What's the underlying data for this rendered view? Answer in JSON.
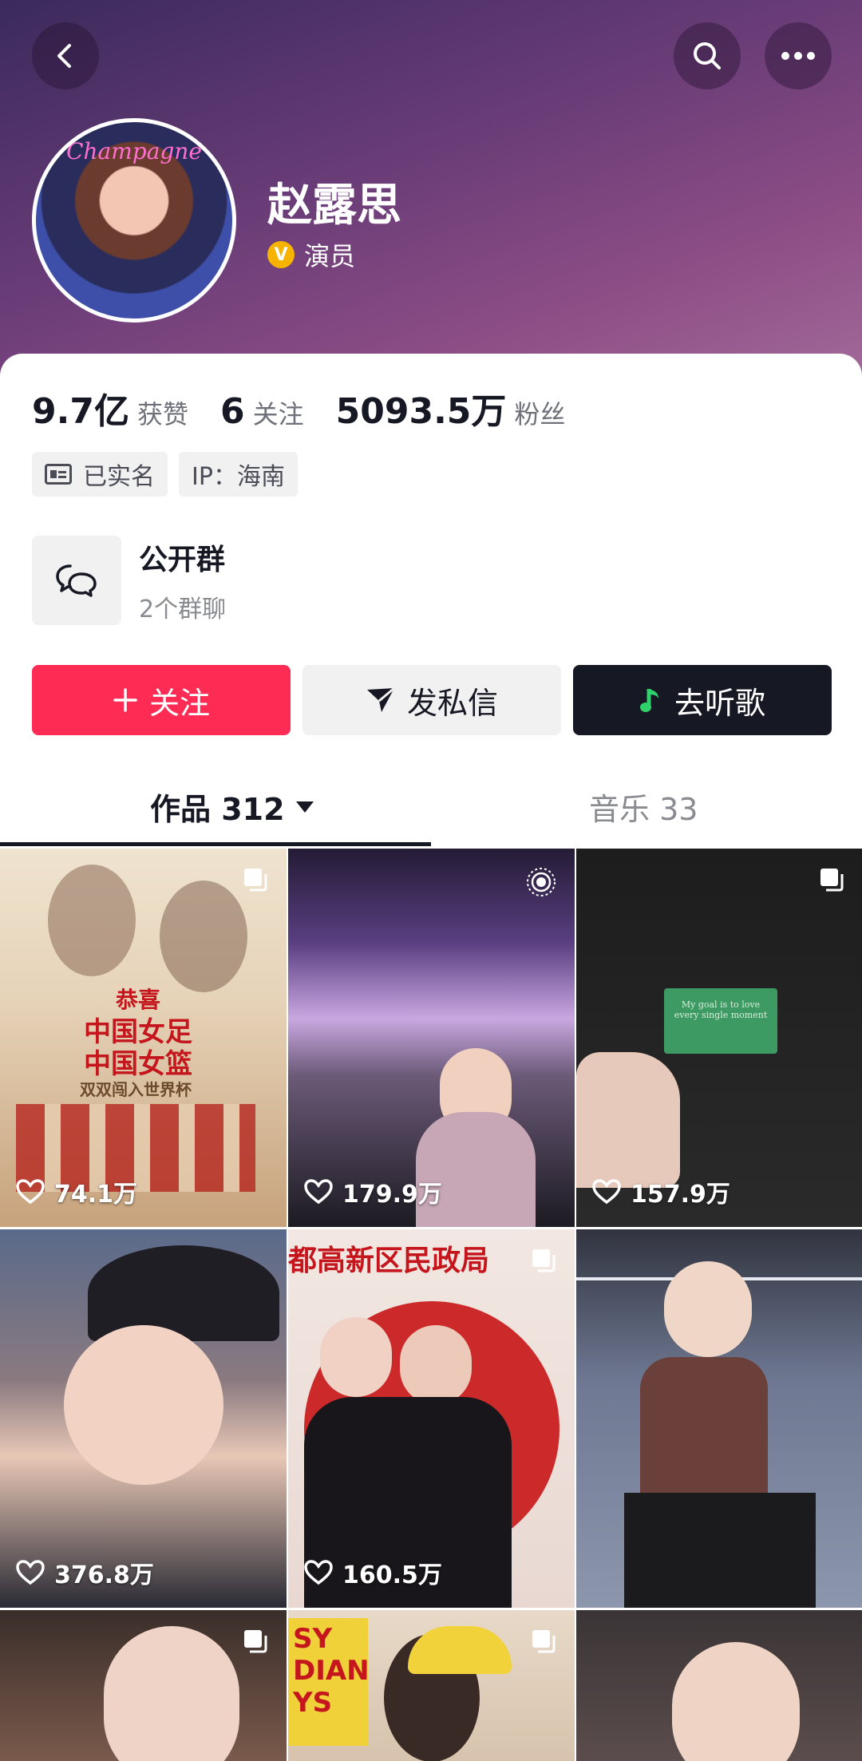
{
  "profile": {
    "name": "赵露思",
    "verify_label": "演员",
    "verify_badge": "V",
    "avatar_text": "Champagne"
  },
  "stats": {
    "likes_num": "9.7亿",
    "likes_label": "获赞",
    "following_num": "6",
    "following_label": "关注",
    "fans_num": "5093.5万",
    "fans_label": "粉丝"
  },
  "tags": {
    "verified": "已实名",
    "ip": "IP：海南"
  },
  "group": {
    "title": "公开群",
    "subtitle": "2个群聊"
  },
  "actions": {
    "follow": "关注",
    "message": "发私信",
    "music": "去听歌"
  },
  "tabs": {
    "works": "作品 312",
    "music": "音乐 33"
  },
  "videos": [
    {
      "likes": "74.1万",
      "corner": "multi-image-icon",
      "poster_title": "恭喜",
      "poster_line1": "中国女足",
      "poster_line2": "中国女篮",
      "poster_line3": "双双闯入世界杯"
    },
    {
      "likes": "179.9万",
      "corner": "live-photo-icon"
    },
    {
      "likes": "157.9万",
      "corner": "multi-image-icon",
      "card_line1": "My goal is to love",
      "card_line2": "every single moment"
    },
    {
      "likes": "376.8万",
      "corner": ""
    },
    {
      "likes": "160.5万",
      "corner": "multi-image-icon",
      "banner": "都高新区民政局"
    },
    {
      "likes": "",
      "corner": ""
    },
    {
      "likes": "",
      "corner": "multi-image-icon"
    },
    {
      "likes": "",
      "corner": "multi-image-icon",
      "sign": "SY DIAN YS"
    },
    {
      "likes": "",
      "corner": ""
    }
  ],
  "colors": {
    "accent": "#fe2c55",
    "dark": "#161823",
    "header_top": "#3b2a5c",
    "header_bottom": "#a26a99"
  }
}
